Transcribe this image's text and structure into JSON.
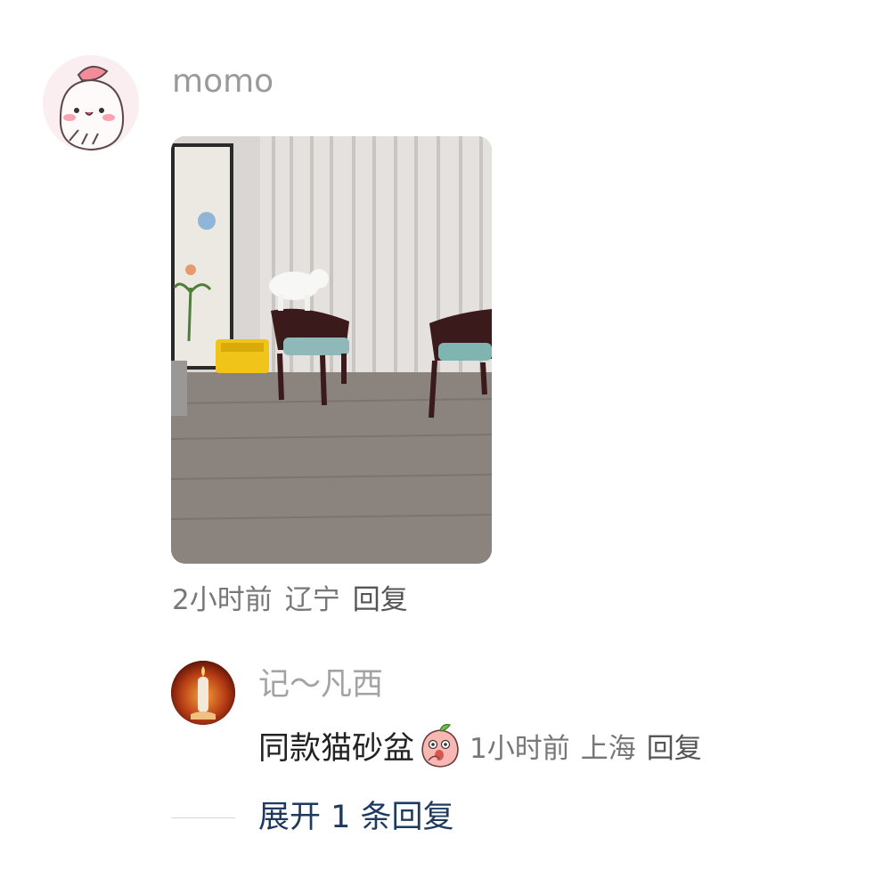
{
  "comment": {
    "username": "momo",
    "time": "2小时前",
    "location": "辽宁",
    "reply_label": "回复"
  },
  "reply": {
    "username": "记～凡西",
    "text": "同款猫砂盆",
    "time": "1小时前",
    "location": "上海",
    "reply_label": "回复"
  },
  "expand_label": "展开 1 条回复",
  "colors": {
    "username": "#9a9a9a",
    "meta": "#777777",
    "link": "#1f3a5f"
  }
}
